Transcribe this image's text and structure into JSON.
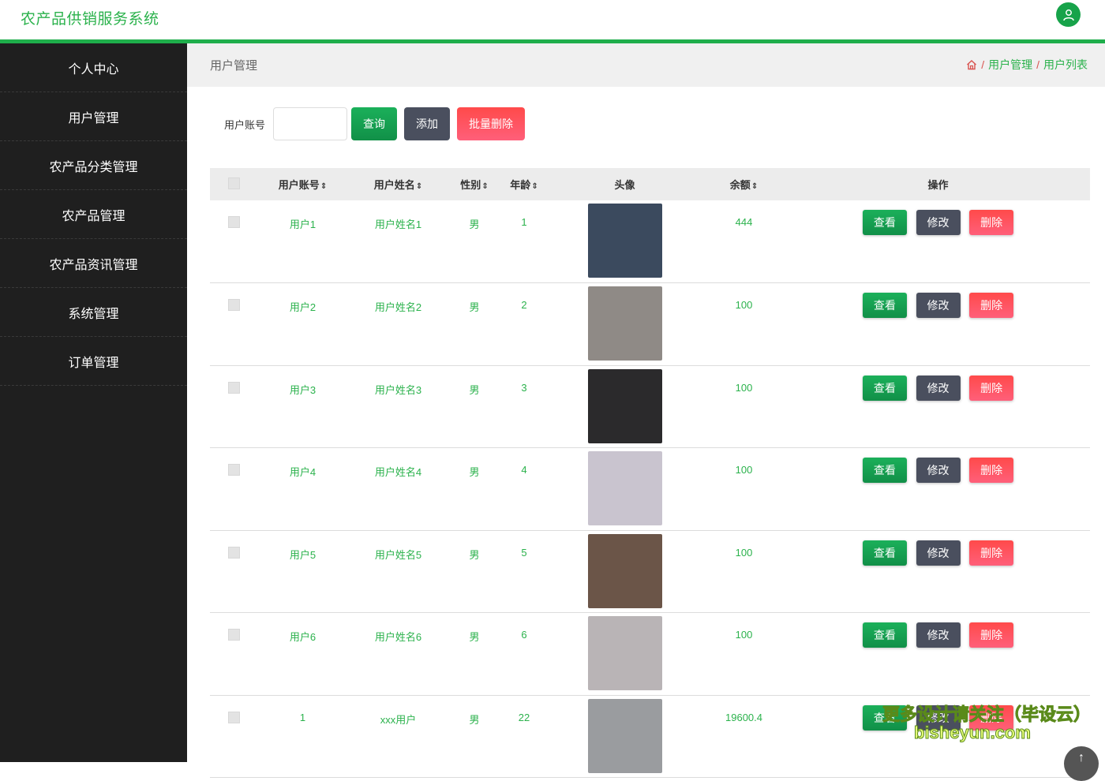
{
  "app": {
    "title": "农产品供销服务系统"
  },
  "sidebar": {
    "items": [
      {
        "label": "个人中心"
      },
      {
        "label": "用户管理"
      },
      {
        "label": "农产品分类管理"
      },
      {
        "label": "农产品管理"
      },
      {
        "label": "农产品资讯管理"
      },
      {
        "label": "系统管理"
      },
      {
        "label": "订单管理"
      }
    ]
  },
  "page": {
    "title": "用户管理",
    "breadcrumb": [
      "用户管理",
      "用户列表"
    ]
  },
  "search": {
    "label": "用户账号",
    "value": "",
    "query_label": "查询",
    "add_label": "添加",
    "batch_delete_label": "批量删除"
  },
  "table": {
    "columns": [
      "用户账号",
      "用户姓名",
      "性别",
      "年龄",
      "头像",
      "余额",
      "操作"
    ],
    "view_label": "查看",
    "edit_label": "修改",
    "delete_label": "删除",
    "rows": [
      {
        "account": "用户1",
        "name": "用户姓名1",
        "gender": "男",
        "age": "1",
        "balance": "444",
        "photo_color": "#3b4a5e"
      },
      {
        "account": "用户2",
        "name": "用户姓名2",
        "gender": "男",
        "age": "2",
        "balance": "100",
        "photo_color": "#8f8a86"
      },
      {
        "account": "用户3",
        "name": "用户姓名3",
        "gender": "男",
        "age": "3",
        "balance": "100",
        "photo_color": "#2b2a2c"
      },
      {
        "account": "用户4",
        "name": "用户姓名4",
        "gender": "男",
        "age": "4",
        "balance": "100",
        "photo_color": "#c9c4cf"
      },
      {
        "account": "用户5",
        "name": "用户姓名5",
        "gender": "男",
        "age": "5",
        "balance": "100",
        "photo_color": "#6b5548"
      },
      {
        "account": "用户6",
        "name": "用户姓名6",
        "gender": "男",
        "age": "6",
        "balance": "100",
        "photo_color": "#b9b4b6"
      },
      {
        "account": "1",
        "name": "xxx用户",
        "gender": "男",
        "age": "22",
        "balance": "19600.4",
        "photo_color": "#9a9c9f"
      }
    ]
  },
  "watermark": {
    "line1": "更多设计请关注（毕设云）",
    "line2": "bisheyun.com"
  },
  "colors": {
    "accent": "#2bb24c",
    "sidebar_bg": "#1f1f1f",
    "danger": "#ff4a4a",
    "neutral_btn": "#4a4f5e"
  }
}
